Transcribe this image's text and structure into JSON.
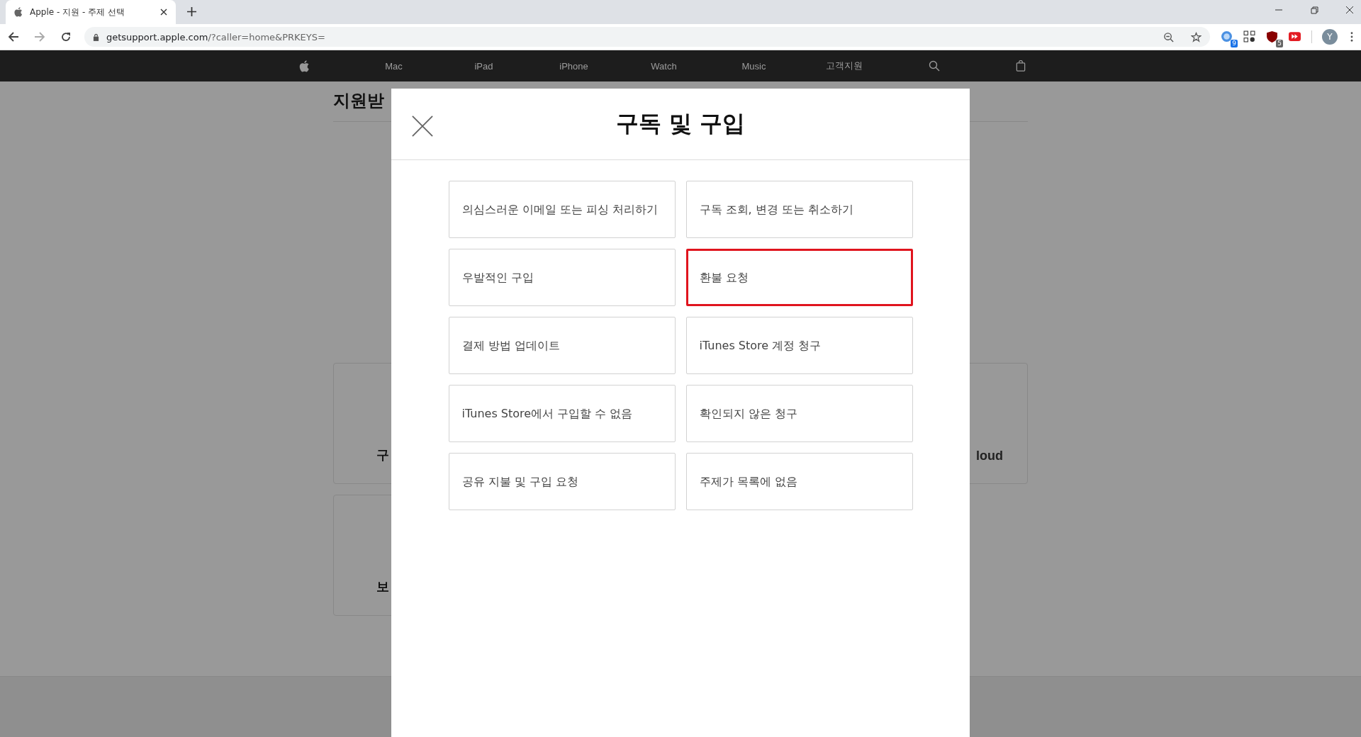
{
  "browser": {
    "tab": {
      "title": "Apple - 지원 - 주제 선택",
      "selected": true
    },
    "url": {
      "host": "getsupport.apple.com",
      "path": "/?caller=home&PRKEYS="
    },
    "extensions": [
      {
        "kind": "globe",
        "badge": "9"
      },
      {
        "kind": "qr"
      },
      {
        "kind": "shield",
        "badge": "5"
      },
      {
        "kind": "play"
      }
    ],
    "profile": "Y"
  },
  "nav": {
    "items": [
      "Mac",
      "iPad",
      "iPhone",
      "Watch",
      "Music",
      "고객지원"
    ]
  },
  "page": {
    "heading": "지원받",
    "cards_left": [
      "구",
      "보"
    ],
    "cards_right": [
      "loud"
    ]
  },
  "modal": {
    "title": "구독 및 구입",
    "options": [
      {
        "label": "의심스러운 이메일 또는 피싱 처리하기",
        "selected": false
      },
      {
        "label": "구독 조회, 변경 또는 취소하기",
        "selected": false
      },
      {
        "label": "우발적인 구입",
        "selected": false
      },
      {
        "label": "환불 요청",
        "selected": true
      },
      {
        "label": "결제 방법 업데이트",
        "selected": false
      },
      {
        "label": "iTunes Store 계정 청구",
        "selected": false
      },
      {
        "label": "iTunes Store에서 구입할 수 없음",
        "selected": false
      },
      {
        "label": "확인되지 않은 청구",
        "selected": false
      },
      {
        "label": "공유 지불 및 구입 요청",
        "selected": false
      },
      {
        "label": "주제가 목록에 없음",
        "selected": false
      }
    ]
  }
}
